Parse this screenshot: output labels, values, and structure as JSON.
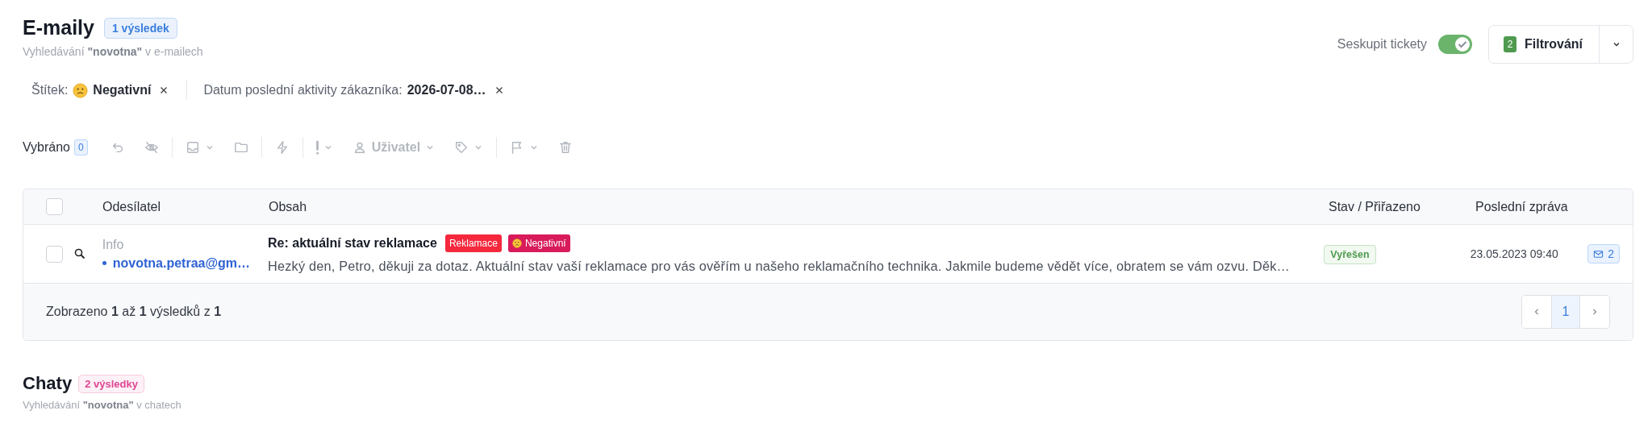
{
  "emails": {
    "title": "E-maily",
    "badge": "1 výsledek",
    "color": "#3b7ddd",
    "subtitle": "Vyhledávání **\"novotna\"** v e-mailech",
    "group_toggle": {
      "label": "Seskupit tickety",
      "on": true
    },
    "filter_button": {
      "count": "2",
      "label": "Filtrování"
    },
    "active_filters": [
      {
        "label": "Štítek:",
        "value": "Negativní",
        "emoji": true
      },
      {
        "label": "Datum poslední aktivity zákazníka:",
        "value": "2026-07-08…",
        "emoji": false
      }
    ],
    "selection": {
      "label": "Vybráno",
      "count": "0"
    },
    "toolbar_groups": [
      [
        {
          "disabled": true,
          "dropdown": false
        },
        {
          "disabled": true,
          "dropdown": false
        }
      ],
      [
        {
          "disabled": true,
          "dropdown": true
        },
        {
          "disabled": true,
          "dropdown": false
        }
      ],
      [
        {
          "disabled": true,
          "dropdown": false
        }
      ],
      [
        {
          "disabled": true,
          "dropdown": true
        },
        {
          "disabled": true,
          "dropdown": true,
          "label": "Uživatel"
        },
        {
          "disabled": true,
          "dropdown": true
        }
      ],
      [
        {
          "disabled": true,
          "dropdown": true
        },
        {
          "disabled": true,
          "dropdown": false
        }
      ]
    ],
    "table": {
      "all_checked": false,
      "columns": [
        "Odesílatel",
        "Obsah",
        "Stav / Přiřazeno",
        "Poslední zpráva"
      ],
      "rows": [
        {
          "checked": false,
          "sender_name": "Info",
          "sender_email": "novotna.petraa@gm…",
          "subject": "Re: aktuální stav reklamace",
          "tags": [
            {
              "label": "Reklamace",
              "color": "#f5283d",
              "emoji": false
            },
            {
              "label": "Negativní",
              "color": "#d81b5a",
              "emoji": true
            }
          ],
          "preview": "Hezký den, Petro, děkuji za dotaz. Aktuální stav vaší reklamace pro vás ověřím u našeho reklamačního technika. Jakmile budeme vědět více, obratem se vám ozvu. Děk…",
          "status": "Vyřešen",
          "last_message": "23.05.2023 09:40",
          "message_count": "2"
        }
      ],
      "footer": "Zobrazeno **1** až **1** výsledků z **1**",
      "pages": [
        {
          "label": "1",
          "selected": true
        }
      ]
    }
  },
  "chats": {
    "title": "Chaty",
    "badge": "2 výsledky",
    "color": "#e04592",
    "subtitle": "Vyhledávání **\"novotna\"** v chatech"
  }
}
